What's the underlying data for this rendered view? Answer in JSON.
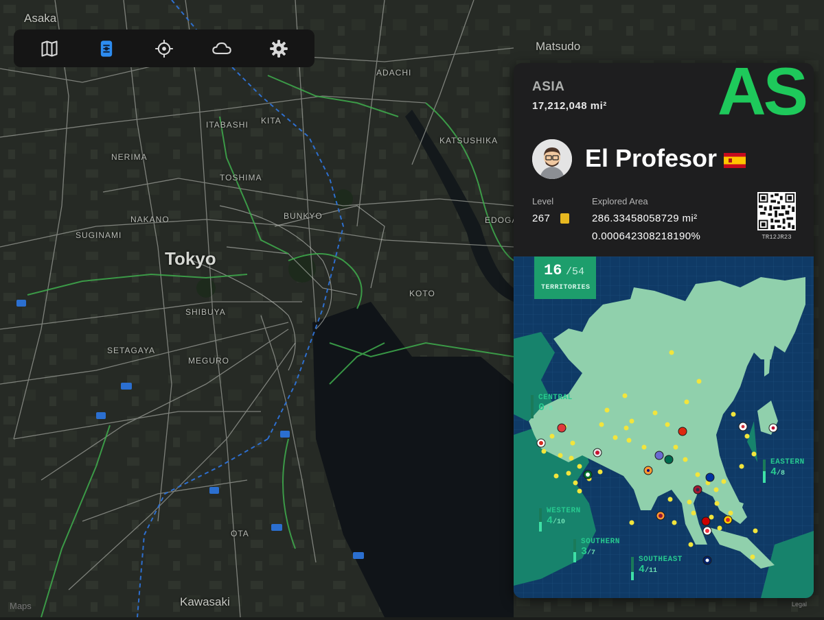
{
  "toolbar": {
    "items": [
      {
        "icon": "map-icon",
        "active": false
      },
      {
        "icon": "layers-icon",
        "active": true
      },
      {
        "icon": "locate-icon",
        "active": false
      },
      {
        "icon": "cloud-icon",
        "active": false
      },
      {
        "icon": "gear-icon",
        "active": false
      }
    ],
    "accent": "#2d8cf0"
  },
  "map": {
    "labels": {
      "asaka": "Asaka",
      "matsudo": "Matsudo",
      "adachi": "ADACHI",
      "itabashi": "ITABASHI",
      "kita": "KITA",
      "katsushika": "KATSUSHIKA",
      "nerima": "NERIMA",
      "toshima": "TOSHIMA",
      "nakano": "NAKANO",
      "suginami": "SUGINAMI",
      "bunkyo": "BUNKYO",
      "edogawa": "EDOGAWA",
      "tokyo": "Tokyo",
      "shibuya": "SHIBUYA",
      "koto": "KOTO",
      "setagaya": "SETAGAYA",
      "meguro": "MEGURO",
      "ota": "OTA",
      "kawasaki": "Kawasaki"
    },
    "maps_logo": "Maps",
    "legal": "Legal"
  },
  "panel": {
    "continent_name": "ASIA",
    "continent_area": "17,212,048 mi²",
    "continent_code": "AS",
    "continent_color": "#1ec95b",
    "player_name": "El Profesor",
    "country_flag": "spain-flag",
    "level_label": "Level",
    "level_value": "267",
    "explored_label": "Explored Area",
    "explored_area": "286.33458058729 mi²",
    "explored_percent": "0.000642308218190%",
    "qr_code": "TR12JR23",
    "territories": {
      "count": "16",
      "total": "/54",
      "label": "TERRITORIES"
    },
    "regions": [
      {
        "key": "central",
        "name": "CENTRAL",
        "count": "0",
        "total": "/8",
        "fraction": 0.0
      },
      {
        "key": "eastern",
        "name": "EASTERN",
        "count": "4",
        "total": "/8",
        "fraction": 0.5
      },
      {
        "key": "western",
        "name": "WESTERN",
        "count": "4",
        "total": "/10",
        "fraction": 0.4
      },
      {
        "key": "southern",
        "name": "SOUTHERN",
        "count": "3",
        "total": "/7",
        "fraction": 0.43
      },
      {
        "key": "southeast",
        "name": "SOUTHEAST",
        "count": "4",
        "total": "/11",
        "fraction": 0.36
      }
    ]
  }
}
